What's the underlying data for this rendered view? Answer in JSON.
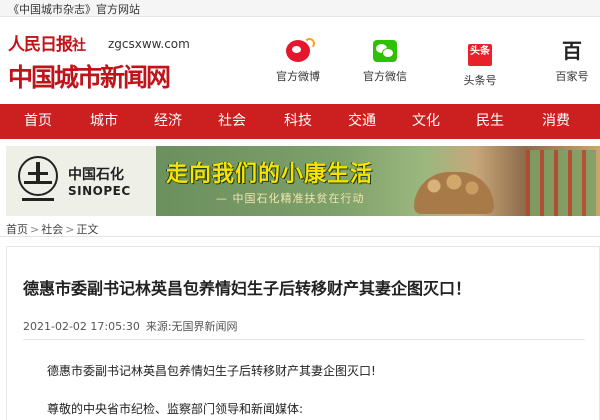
{
  "topbar": {
    "text": "《中国城市杂志》官方网站"
  },
  "logo": {
    "brand": "人民日报",
    "she": "社",
    "url": "zgcsxww.com",
    "main": "中国城市新闻网"
  },
  "social": [
    {
      "label": "官方微博",
      "icon": "weibo-icon"
    },
    {
      "label": "官方微信",
      "icon": "wechat-icon"
    },
    {
      "label": "头条号",
      "icon": "toutiao-icon",
      "icon_text": "头条"
    },
    {
      "label": "百家号",
      "icon": "baijiahao-icon",
      "icon_text": "百"
    }
  ],
  "nav": [
    "首页",
    "城市",
    "经济",
    "社会",
    "科技",
    "交通",
    "文化",
    "民生",
    "消费"
  ],
  "banner": {
    "brand_cn": "中国石化",
    "brand_en": "SINOPEC",
    "slogan": "走向我们的小康生活",
    "subtitle": "— 中国石化精准扶贫在行动"
  },
  "breadcrumb": [
    "首页",
    "社会",
    "正文"
  ],
  "article": {
    "title": "德惠市委副书记林英昌包养情妇生子后转移财产其妻企图灭口！",
    "datetime": "2021-02-02 17:05:30",
    "source": "来源:无国界新闻网",
    "paragraphs": [
      "德惠市委副书记林英昌包养情妇生子后转移财产其妻企图灭口!",
      "尊敬的中央省市纪检、监察部门领导和新闻媒体:"
    ]
  },
  "colors": {
    "brand_red": "#c0141a",
    "nav_red": "#cc1f1f",
    "slogan_yellow": "#f7e200"
  }
}
